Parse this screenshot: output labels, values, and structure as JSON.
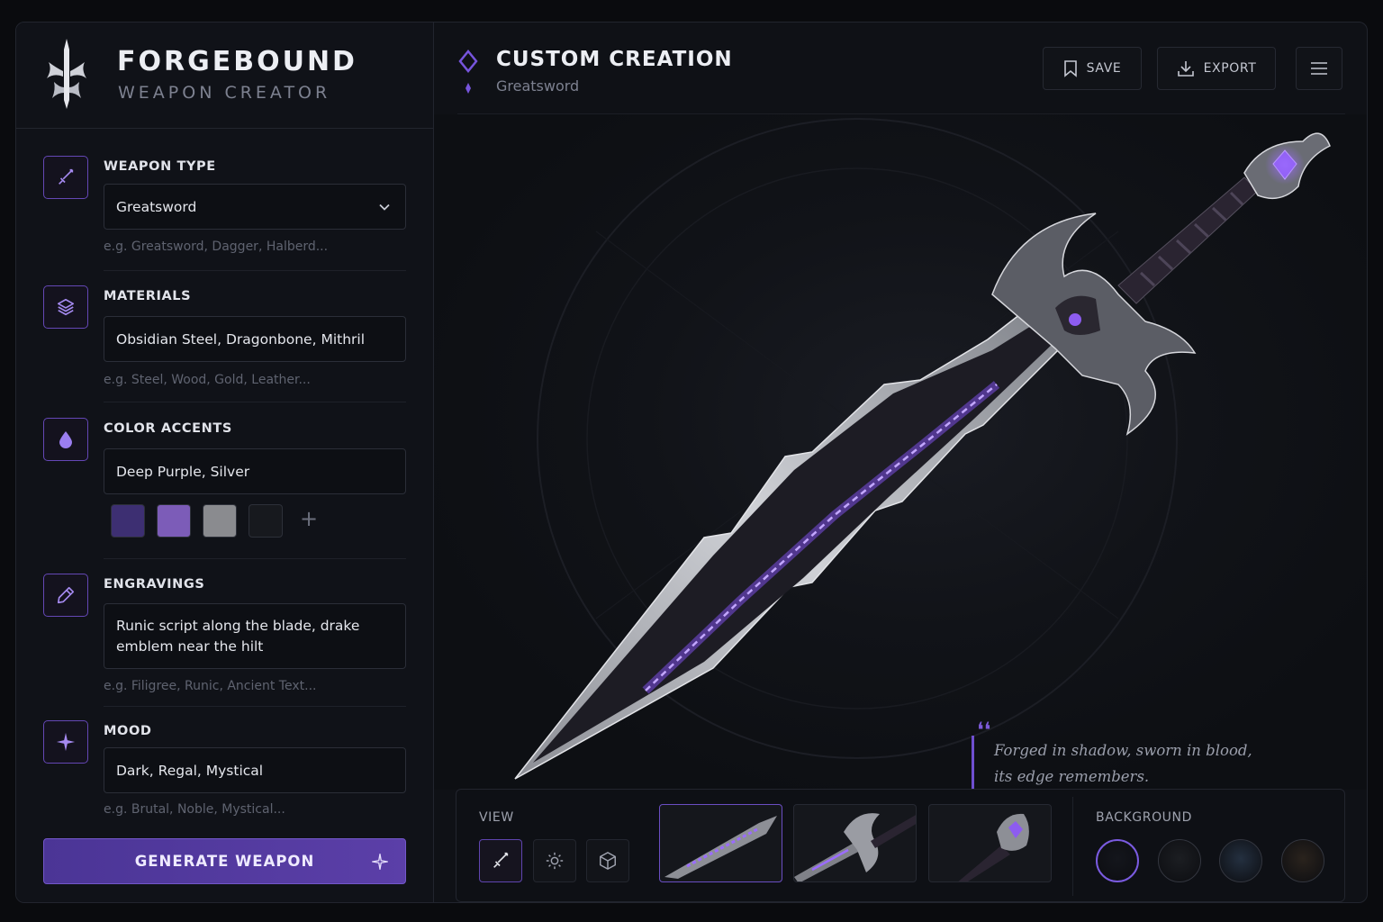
{
  "brand": {
    "title": "FORGEBOUND",
    "subtitle": "WEAPON CREATOR"
  },
  "sidebar": {
    "weapon_type": {
      "label": "WEAPON TYPE",
      "value": "Greatsword",
      "hint": "e.g. Greatsword, Dagger, Halberd...",
      "icon": "sword-icon"
    },
    "materials": {
      "label": "MATERIALS",
      "value": "Obsidian Steel, Dragonbone, Mithril",
      "hint": "e.g. Steel, Wood, Gold, Leather...",
      "icon": "layers-icon"
    },
    "color_accents": {
      "label": "COLOR ACCENTS",
      "value": "Deep Purple, Silver",
      "icon": "droplet-icon",
      "swatches": [
        "#3d2f72",
        "#7c5cb8",
        "#8a8b8f",
        "#17191e"
      ]
    },
    "engravings": {
      "label": "ENGRAVINGS",
      "value": "Runic script along the blade, drake emblem near the hilt",
      "hint": "e.g. Filigree, Runic, Ancient Text...",
      "icon": "pen-icon"
    },
    "mood": {
      "label": "MOOD",
      "value": "Dark, Regal, Mystical",
      "hint": "e.g. Brutal, Noble, Mystical...",
      "icon": "sparkle-icon"
    },
    "generate_label": "GENERATE WEAPON"
  },
  "header": {
    "title": "CUSTOM CREATION",
    "subtitle": "Greatsword",
    "save_label": "SAVE",
    "export_label": "EXPORT"
  },
  "preview": {
    "quote_line1": "Forged in shadow, sworn in blood,",
    "quote_line2": "its edge remembers."
  },
  "bottom": {
    "view_label": "VIEW",
    "background_label": "BACKGROUND",
    "view_modes": [
      "sword-icon",
      "sun-icon",
      "cube-icon"
    ],
    "background_colors": [
      "#14161c",
      "#1c1e22",
      "#243040",
      "#2a231d"
    ]
  },
  "colors": {
    "accent": "#6a4ec2",
    "button": "#4b3596"
  }
}
